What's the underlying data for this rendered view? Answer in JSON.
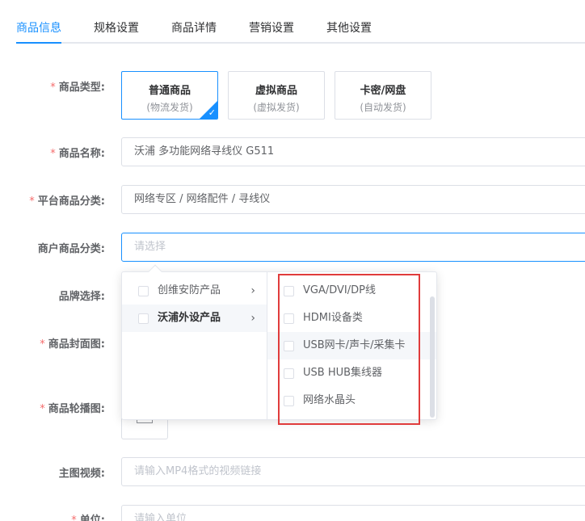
{
  "tabs": [
    {
      "label": "商品信息",
      "active": true
    },
    {
      "label": "规格设置",
      "active": false
    },
    {
      "label": "商品详情",
      "active": false
    },
    {
      "label": "营销设置",
      "active": false
    },
    {
      "label": "其他设置",
      "active": false
    }
  ],
  "form": {
    "required_mark": "*",
    "product_type": {
      "label": "商品类型:",
      "options": [
        {
          "title": "普通商品",
          "sub": "(物流发货)",
          "selected": true
        },
        {
          "title": "虚拟商品",
          "sub": "(虚拟发货)",
          "selected": false
        },
        {
          "title": "卡密/网盘",
          "sub": "(自动发货)",
          "selected": false
        }
      ],
      "check_mark": "✓"
    },
    "product_name": {
      "label": "商品名称:",
      "value": "沃浦 多功能网络寻线仪 G511"
    },
    "platform_category": {
      "label": "平台商品分类:",
      "value": "网络专区 / 网络配件 / 寻线仪"
    },
    "merchant_category": {
      "label": "商户商品分类:",
      "placeholder": "请选择"
    },
    "brand": {
      "label": "品牌选择:"
    },
    "cover": {
      "label": "商品封面图:"
    },
    "carousel": {
      "label": "商品轮播图:"
    },
    "video": {
      "label": "主图视频:",
      "placeholder": "请输入MP4格式的视频链接"
    },
    "unit": {
      "label": "单位:",
      "placeholder": "请输入单位"
    }
  },
  "cascader": {
    "level1": [
      {
        "label": "创维安防产品",
        "active": false
      },
      {
        "label": "沃浦外设产品",
        "active": true
      }
    ],
    "level2": [
      {
        "label": "VGA/DVI/DP线"
      },
      {
        "label": "HDMI设备类"
      },
      {
        "label": "USB网卡/声卡/采集卡"
      },
      {
        "label": "USB HUB集线器"
      },
      {
        "label": "网络水晶头"
      }
    ],
    "chevron": "›"
  },
  "colors": {
    "accent": "#1890ff",
    "required": "#f56c6c",
    "highlight": "#e03c3c"
  }
}
